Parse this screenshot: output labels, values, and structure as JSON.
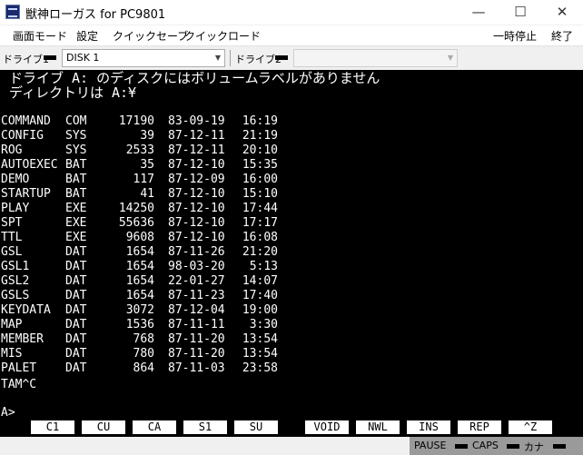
{
  "window": {
    "title": "獣神ローガス for PC9801",
    "minimize": "—",
    "maximize": "☐",
    "close": "✕"
  },
  "menu": {
    "items": [
      "画面モード",
      "設定",
      "クイックセーブ",
      "クイックロード"
    ],
    "right": [
      "一時停止",
      "終了"
    ]
  },
  "drives": {
    "drive1_label": "ドライブ1",
    "drive1_value": "DISK 1",
    "drive2_label": "ドライブ2",
    "drive2_value": ""
  },
  "screen": {
    "line1": "ドライブ A: のディスクにはボリュームラベルがありません",
    "line2": "ディレクトリは A:¥",
    "files": [
      {
        "name": "COMMAND",
        "ext": "COM",
        "size": "17190",
        "date": "83-09-19",
        "time": "16:19"
      },
      {
        "name": "CONFIG",
        "ext": "SYS",
        "size": "39",
        "date": "87-12-11",
        "time": "21:19"
      },
      {
        "name": "ROG",
        "ext": "SYS",
        "size": "2533",
        "date": "87-12-11",
        "time": "20:10"
      },
      {
        "name": "AUTOEXEC",
        "ext": "BAT",
        "size": "35",
        "date": "87-12-10",
        "time": "15:35"
      },
      {
        "name": "DEMO",
        "ext": "BAT",
        "size": "117",
        "date": "87-12-09",
        "time": "16:00"
      },
      {
        "name": "STARTUP",
        "ext": "BAT",
        "size": "41",
        "date": "87-12-10",
        "time": "15:10"
      },
      {
        "name": "PLAY",
        "ext": "EXE",
        "size": "14250",
        "date": "87-12-10",
        "time": "17:44"
      },
      {
        "name": "SPT",
        "ext": "EXE",
        "size": "55636",
        "date": "87-12-10",
        "time": "17:17"
      },
      {
        "name": "TTL",
        "ext": "EXE",
        "size": "9608",
        "date": "87-12-10",
        "time": "16:08"
      },
      {
        "name": "GSL",
        "ext": "DAT",
        "size": "1654",
        "date": "87-11-26",
        "time": "21:20"
      },
      {
        "name": "GSL1",
        "ext": "DAT",
        "size": "1654",
        "date": "98-03-20",
        "time": "5:13"
      },
      {
        "name": "GSL2",
        "ext": "DAT",
        "size": "1654",
        "date": "22-01-27",
        "time": "14:07"
      },
      {
        "name": "GSLS",
        "ext": "DAT",
        "size": "1654",
        "date": "87-11-23",
        "time": "17:40"
      },
      {
        "name": "KEYDATA",
        "ext": "DAT",
        "size": "3072",
        "date": "87-12-04",
        "time": "19:00"
      },
      {
        "name": "MAP",
        "ext": "DAT",
        "size": "1536",
        "date": "87-11-11",
        "time": "3:30"
      },
      {
        "name": "MEMBER",
        "ext": "DAT",
        "size": "768",
        "date": "87-11-20",
        "time": "13:54"
      },
      {
        "name": "MIS",
        "ext": "DAT",
        "size": "780",
        "date": "87-11-20",
        "time": "13:54"
      },
      {
        "name": "PALET",
        "ext": "DAT",
        "size": "864",
        "date": "87-11-03",
        "time": "23:58"
      }
    ],
    "break_line": "TAM^C",
    "prompt": "A>",
    "fkeys": [
      "C1",
      "CU",
      "CA",
      "S1",
      "SU",
      "VOID",
      "NWL",
      "INS",
      "REP",
      "^Z"
    ]
  },
  "status": {
    "pause": "PAUSE",
    "caps": "CAPS",
    "kana": "カナ"
  }
}
